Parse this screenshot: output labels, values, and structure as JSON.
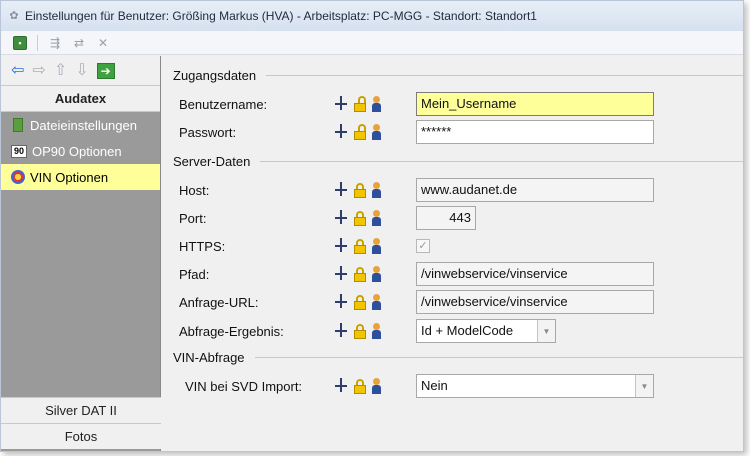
{
  "window": {
    "title": "Einstellungen für Benutzer: Größing Markus (HVA) - Arbeitsplatz: PC-MGG - Standort: Standort1"
  },
  "toolbar": {
    "icons": [
      "save-icon",
      "copy-settings-icon",
      "transfer-settings-icon",
      "delete-settings-icon"
    ]
  },
  "sidebar": {
    "nav": [
      "back-arrow-icon",
      "forward-arrow-icon",
      "up-arrow-icon",
      "down-arrow-icon",
      "go-icon"
    ],
    "group_header": "Audatex",
    "items": [
      {
        "label": "Dateieinstellungen",
        "icon": "document-icon"
      },
      {
        "label": "OP90 Optionen",
        "icon": "op90-icon"
      },
      {
        "label": "VIN Optionen",
        "icon": "vin-icon",
        "selected": true
      }
    ],
    "bottom_items": [
      "Silver DAT II",
      "Fotos"
    ]
  },
  "sections": {
    "access": "Zugangsdaten",
    "server": "Server-Daten",
    "vin": "VIN-Abfrage"
  },
  "fields": {
    "username": {
      "label": "Benutzername:",
      "value": "Mein_Username"
    },
    "password": {
      "label": "Passwort:",
      "value": "******"
    },
    "host": {
      "label": "Host:",
      "value": "www.audanet.de"
    },
    "port": {
      "label": "Port:",
      "value": "443"
    },
    "https": {
      "label": "HTTPS:",
      "checked": true,
      "check_glyph": "✓"
    },
    "path": {
      "label": "Pfad:",
      "value": "/vinwebservice/vinservice"
    },
    "request_url": {
      "label": "Anfrage-URL:",
      "value": "/vinwebservice/vinservice"
    },
    "result": {
      "label": "Abfrage-Ergebnis:",
      "value": "Id + ModelCode"
    },
    "svd_import": {
      "label": "VIN bei SVD Import:",
      "value": "Nein"
    }
  },
  "glyphs": {
    "dropdown": "▼",
    "back": "⇦",
    "forward": "⇨",
    "up": "⇧",
    "down": "⇩",
    "go": "➔"
  },
  "colors": {
    "highlight": "#ffff99",
    "sidebar_bg": "#9a9a9a",
    "lock_gold": "#f2c500"
  }
}
